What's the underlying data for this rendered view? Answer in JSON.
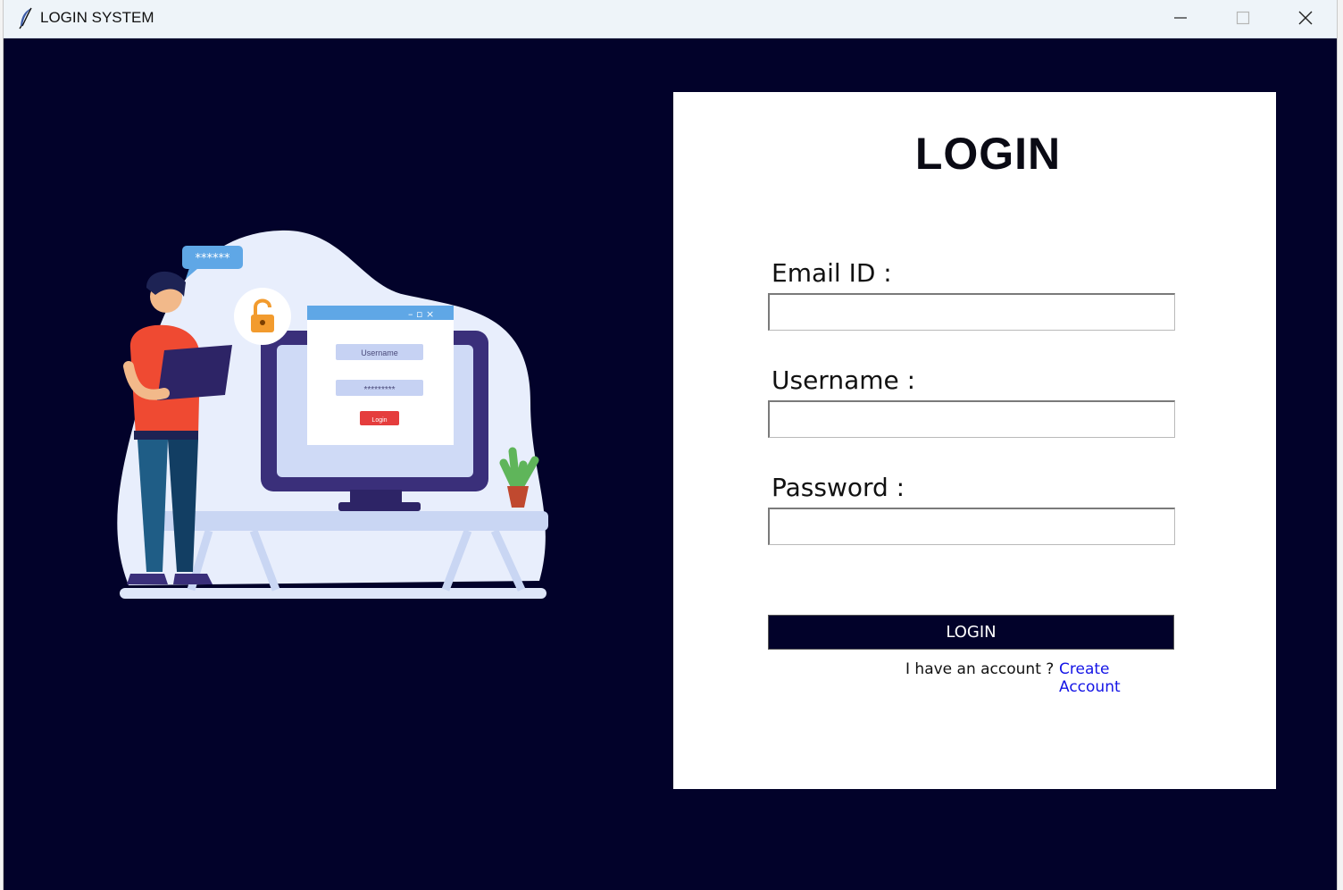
{
  "window": {
    "title": "LOGIN SYSTEM",
    "controls": {
      "minimize": "minimize-icon",
      "maximize": "maximize-icon",
      "close": "close-icon"
    }
  },
  "colors": {
    "background": "#02022a",
    "panel": "#ffffff",
    "button_bg": "#02022a",
    "link": "#1414e6"
  },
  "illustration": {
    "icon": "login-illustration",
    "window_field_username": "Username",
    "window_field_password": "*********",
    "window_button": "Login",
    "speech_bubble": "******"
  },
  "form": {
    "title": "LOGIN",
    "fields": [
      {
        "label": "Email ID :",
        "value": ""
      },
      {
        "label": "Username :",
        "value": ""
      },
      {
        "label": "Password :",
        "value": ""
      }
    ],
    "submit_label": "LOGIN",
    "account_text": "I have an account ?",
    "create_account_label": "Create Account"
  }
}
